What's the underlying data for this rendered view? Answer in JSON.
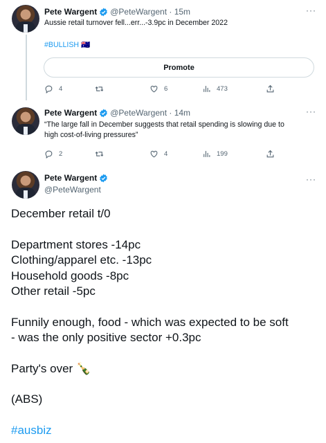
{
  "tweets": [
    {
      "name": "Pete Wargent",
      "handle": "@PeteWargent · 15m",
      "text": "Aussie retail turnover fell...err...-3.9pc in December 2022",
      "hashtag": "#BULLISH 🇦🇺",
      "promote_label": "Promote",
      "replies": "4",
      "retweets": "",
      "likes": "6",
      "views": "473"
    },
    {
      "name": "Pete Wargent",
      "handle": "@PeteWargent · 14m",
      "text_line1": "“The large fall in December suggests that retail spending is slowing due to",
      "text_line2": "high cost-of-living pressures”",
      "replies": "2",
      "retweets": "",
      "likes": "4",
      "views": "199"
    }
  ],
  "main": {
    "name": "Pete Wargent",
    "handle": "@PeteWargent",
    "p1": "December retail t/0",
    "lines": [
      "Department stores -14pc",
      "Clothing/apparel etc. -13pc",
      "Household goods -8pc",
      "Other retail -5pc"
    ],
    "p3_line1": "Funnily enough, food - which was expected to be soft",
    "p3_line2": "- was the only positive sector +0.3pc",
    "p4": "Party's over 🍾",
    "p5": "(ABS)",
    "p6": "#ausbiz"
  },
  "colors": {
    "link": "#1d9bf0",
    "verified": "#1d9bf0",
    "muted": "#536471"
  },
  "icons": [
    "reply-icon",
    "retweet-icon",
    "like-icon",
    "views-icon",
    "share-icon",
    "more-icon",
    "verified-icon"
  ]
}
